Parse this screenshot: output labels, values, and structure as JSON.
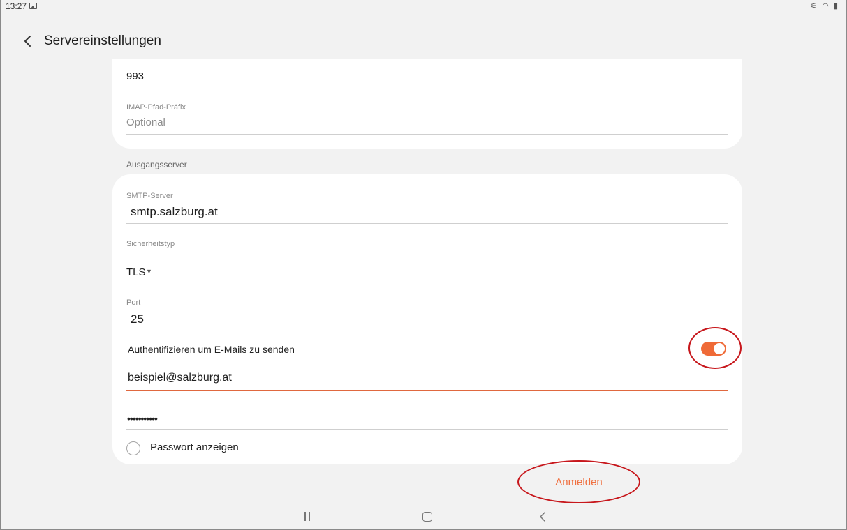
{
  "status": {
    "time": "13:27",
    "right_icons": "⚟ ◠ ▮"
  },
  "header": {
    "title": "Servereinstellungen"
  },
  "incoming": {
    "port_value": "993",
    "imap_prefix_label": "IMAP-Pfad-Präfix",
    "imap_prefix_placeholder": "Optional"
  },
  "outgoing": {
    "section_label": "Ausgangsserver",
    "smtp_label": "SMTP-Server",
    "smtp_value": "smtp.salzburg.at",
    "security_label": "Sicherheitstyp",
    "security_value": "TLS",
    "port_label": "Port",
    "port_value": "25",
    "auth_label": "Authentifizieren um E-Mails zu senden",
    "auth_enabled": true,
    "username_value": "beispiel@salzburg.at",
    "password_value": "•••••••••••",
    "show_password_label": "Passwort anzeigen"
  },
  "actions": {
    "login_label": "Anmelden"
  },
  "colors": {
    "accent": "#ef6a37",
    "annotation": "#c7171c",
    "background": "#f2f2f2"
  },
  "icons": {
    "back": "chevron-left-icon",
    "recent": "recent-apps-icon",
    "home": "home-icon",
    "nav_back": "nav-back-icon",
    "image": "image-icon"
  }
}
